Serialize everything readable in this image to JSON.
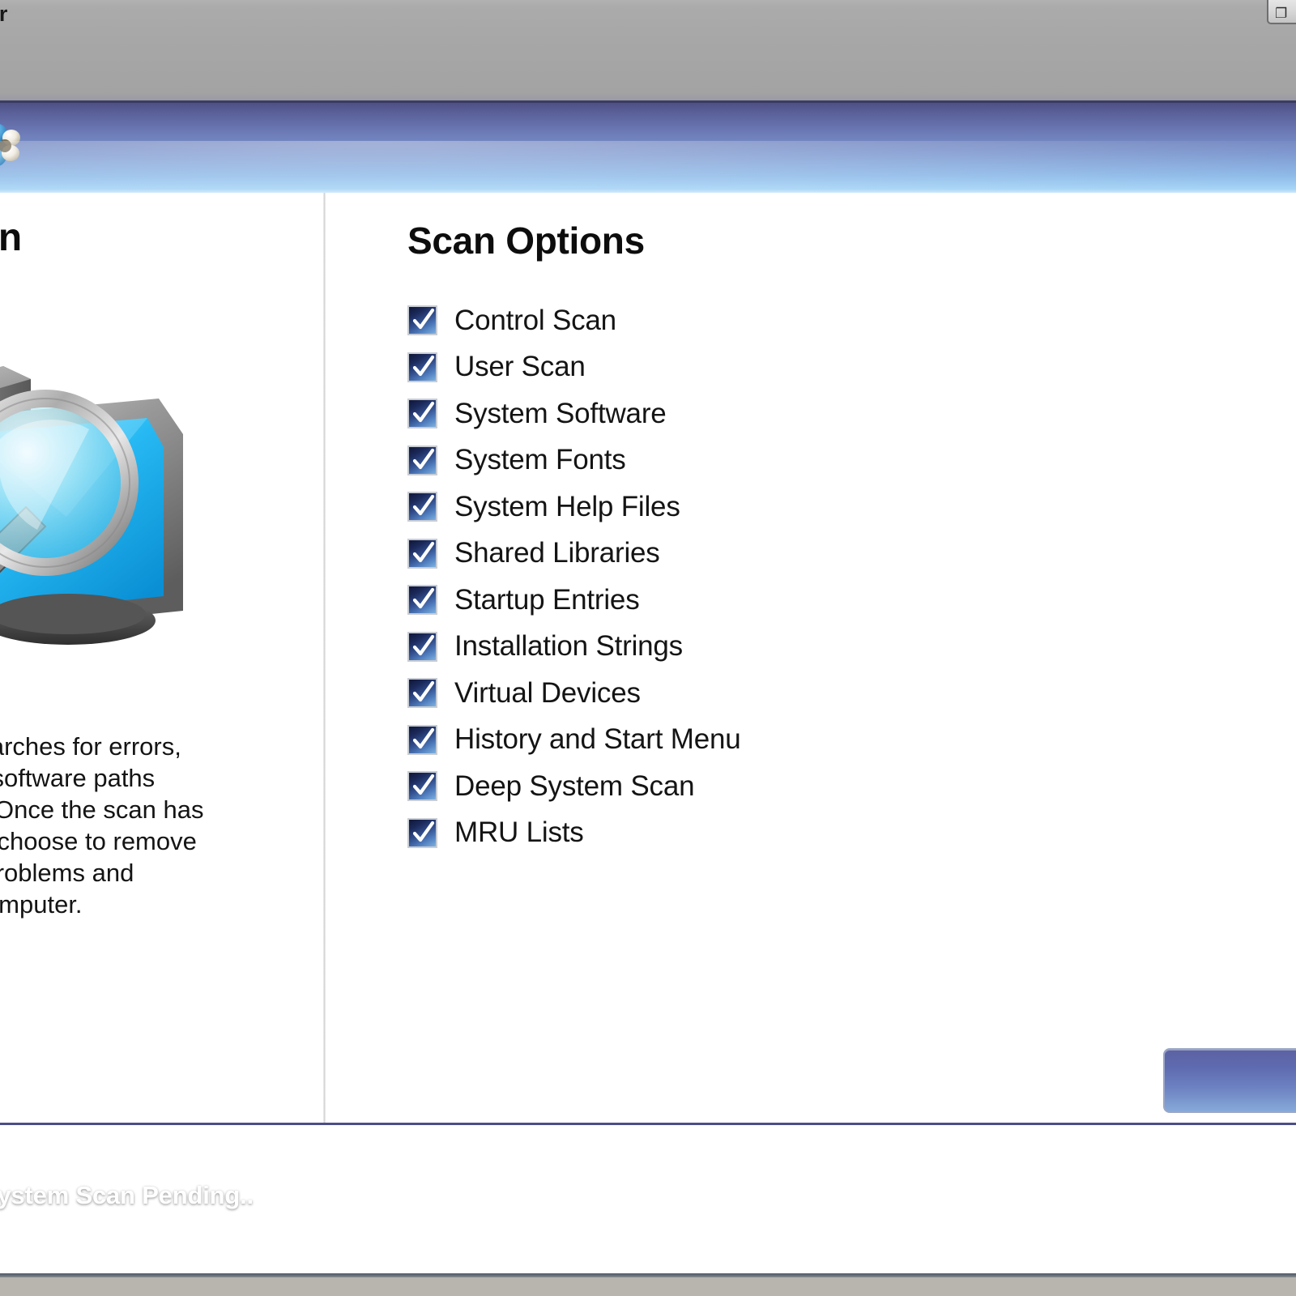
{
  "window": {
    "toolbar_title_visible": "er",
    "window_control_glyph": "❐",
    "window_control_name": "restore-button"
  },
  "header": {
    "logo_icon": "windows-butterfly-logo-icon",
    "title": ""
  },
  "left_panel": {
    "title_visible": "Scan",
    "illustration_icon": "computer-magnifier-scan-icon",
    "description_visible": "an searches for errors,\n, and software paths\nexist. Once the scan has\nu can choose to remove\nking problems and\nour computer."
  },
  "right_panel": {
    "title": "Scan Options",
    "options": [
      {
        "label": "Control Scan",
        "checked": true
      },
      {
        "label": "User Scan",
        "checked": true
      },
      {
        "label": "System Software",
        "checked": true
      },
      {
        "label": "System Fonts",
        "checked": true
      },
      {
        "label": "System Help Files",
        "checked": true
      },
      {
        "label": "Shared Libraries",
        "checked": true
      },
      {
        "label": "Startup Entries",
        "checked": true
      },
      {
        "label": "Installation Strings",
        "checked": true
      },
      {
        "label": "Virtual Devices",
        "checked": true
      },
      {
        "label": "History and Start Menu",
        "checked": true
      },
      {
        "label": "Deep System Scan",
        "checked": true
      },
      {
        "label": "MRU Lists",
        "checked": true
      }
    ]
  },
  "action_button": {
    "label": ""
  },
  "statusbar": {
    "text": "System Scan Pending.."
  },
  "colors": {
    "toolbar_gray": "#a7a7a7",
    "header_top": "#4a4c7e",
    "header_bottom": "#a6d4f6",
    "status_top": "#272c6f",
    "status_bottom": "#b7d8f1",
    "checkbox_dark": "#0f1638",
    "checkbox_light": "#7fb2e0",
    "text_primary": "#141414",
    "text_on_blue": "#ffffff"
  }
}
